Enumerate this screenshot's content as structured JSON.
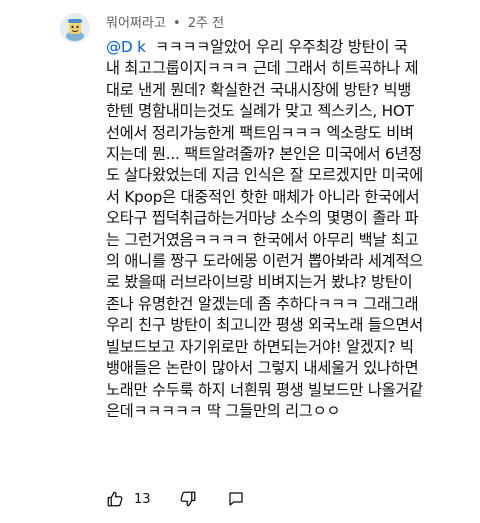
{
  "comment": {
    "author": "뭐어쩌라고",
    "separator": "•",
    "time": "2주 전",
    "mention": "@D k",
    "lines": [
      "ㅋㅋㅋㅋ알았어 우리 우주최강 방탄이 국",
      "내 최고그룹이지ㅋㅋㅋ 근데 그래서 히트곡하나 제",
      "대로 낸게 뭔데?  확실한건 국내시장에 방탄? 빅뱅",
      "한텐 명함내미는것도 실례가 맞고 젝스키스, HOT",
      "선에서 정리가능한게 팩트임ㅋㅋㅋ 엑소랑도 비벼",
      "지는데 뭔... 팩트알려줄까? 본인은 미국에서 6년정",
      "도 살다왔었는데 지금 인식은 잘 모르겠지만 미국에",
      "서 Kpop은 대중적인 핫한 매체가 아니라 한국에서",
      "오타구 찝덕취급하는거마냥 소수의 몇명이 졸라 파",
      "는 그런거였음ㅋㅋㅋㅋ 한국에서 아무리 백날 최고",
      "의 애니를 짱구 도라에몽 이런거 뽑아봐라 세계적으",
      "로 봤을때 러브라이브랑 비벼지는거 봤냐? 방탄이",
      "존나 유명한건 알겠는데 좀 추하다ㅋㅋㅋ 그래그래",
      "우리 친구 방탄이 최고니깐 평생 외국노래 들으면서",
      "빌보드보고 자기위로만 하면되는거야! 알겠지? 빅",
      "뱅애들은 논란이 많아서 그렇지 내세울거 있나하면",
      "노래만 수두룩 하지 너흰뭐 평생 빌보드만 나올거같",
      "은데ㅋㅋㅋㅋㅋ 딱 그들만의 리그ㅇㅇ"
    ],
    "like_count": "13",
    "icons": {
      "like": "thumbs-up-icon",
      "dislike": "thumbs-down-icon",
      "reply": "comment-reply-icon"
    },
    "colors": {
      "text": "#0f0f0f",
      "meta": "#606060",
      "mention": "#065fd4"
    }
  }
}
